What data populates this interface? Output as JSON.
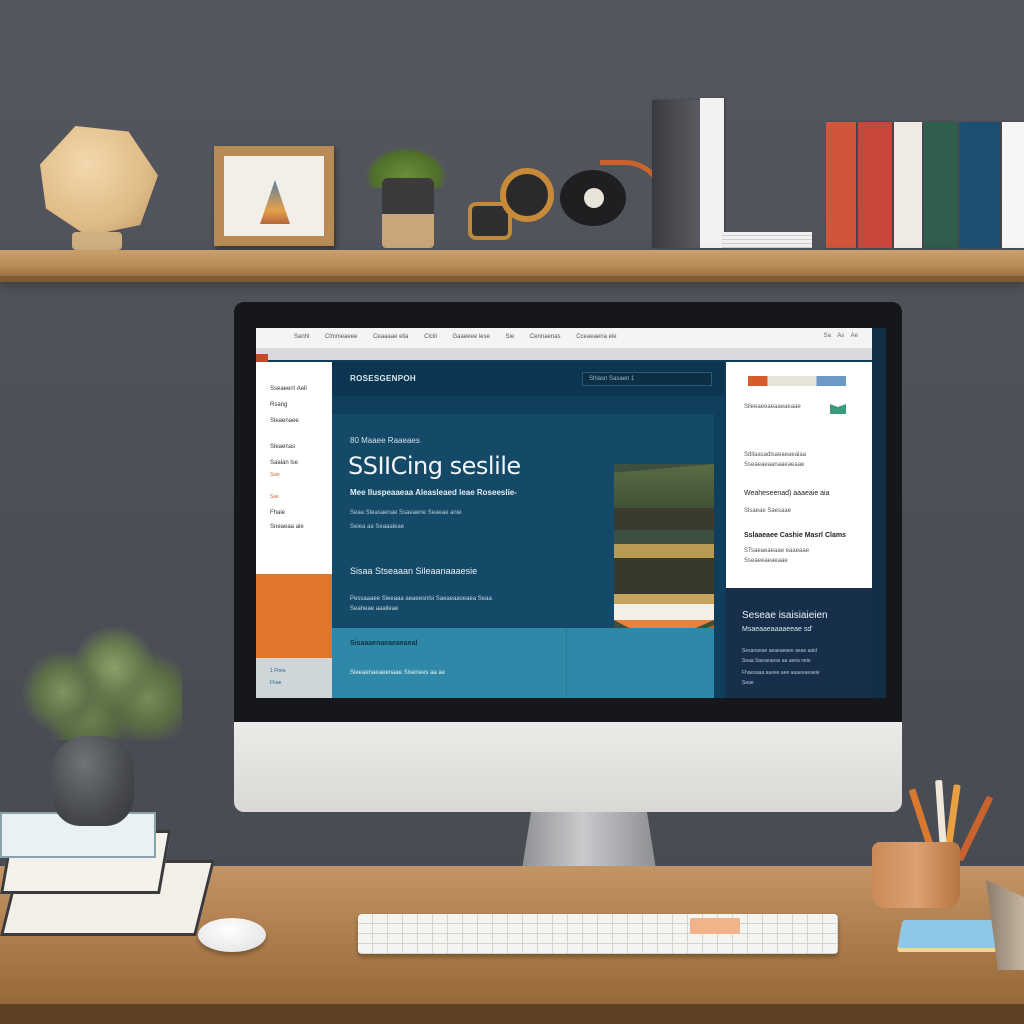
{
  "screen": {
    "topbar": {
      "nav": [
        "Sanhl",
        "Clmmeaeee",
        "Ceaaaae elia",
        "Clclil",
        "Gaaeeee lese",
        "Sie",
        "Cennaenas",
        "Cceaeaena eie"
      ],
      "right": [
        "Sa",
        "As",
        "Ae"
      ]
    },
    "sidebar": {
      "items": [
        "Sseaeen! Aell",
        "Rsang",
        "Sleaenaee",
        "Sleaenas",
        "Saalan lse",
        "Fhaie",
        "Sneaeaa aie"
      ],
      "tags": [
        "Ssie",
        "Sae"
      ]
    },
    "side_footer": [
      "1 Fhea",
      "Fhae"
    ],
    "header": {
      "brand": "ROSESGENPOH",
      "search_value": "Shlasn   Sasaen 1"
    },
    "hero": {
      "eyebrow": "80 Maaee Raaeaes",
      "title": "SSIICing seslile",
      "subtitle": "Mee Iluspeaaeaa Aleasleaed leae Roseeslie-",
      "line1": "Seaa Sleasaenae Ssaeaene Seaeae anie",
      "line2": "Seiea aa Seaaaleae",
      "section_title": "Sisaa Stseaaan Sileaanaaaesie",
      "section_body1": "Pessaaaee Sieeaaa aeaeesnlsi Saeaeaaseaea Seaa",
      "section_body2": "Seaheae aaaileae"
    },
    "strip": {
      "heading": "Sisaaaenaeaeaeaeal",
      "body": "Sieeaenaeaeenaae Sisenees aa ae"
    },
    "right_panel": {
      "small1": "Slleeaeeaeaaeaeaae",
      "line1": "Sdllaasadlsaeaeaealaa",
      "line2": "Sseaeaeaanaaeaeaae",
      "line3": "Weaheseenad) aaaeaie aia",
      "line4": "Slsaeae   Saesaae",
      "line5": "Sslaaeaee Cashie Masrl Clams",
      "line6": "STsaeaeaeaae eaaeaae",
      "line7": "Sseaeeaeaeaae"
    },
    "dark_panel": {
      "heading": "Seseae isaisiaieien",
      "sub": "Msaeaaeaaaaeeae sd'",
      "lines": [
        "Sesanaeae aeaeaeaee aeae aaid",
        "Seaa Saeaeaeas aa aeea neie",
        "Fhaesaaa aaeee aee aaaeeaeaeie",
        "Seae"
      ]
    }
  },
  "colors": {
    "wall": "#4d4f57",
    "screen_main": "#0f3f5c",
    "accent_orange": "#e0762a",
    "accent_teal": "#2f88a8",
    "desk_wood": "#a67645"
  }
}
